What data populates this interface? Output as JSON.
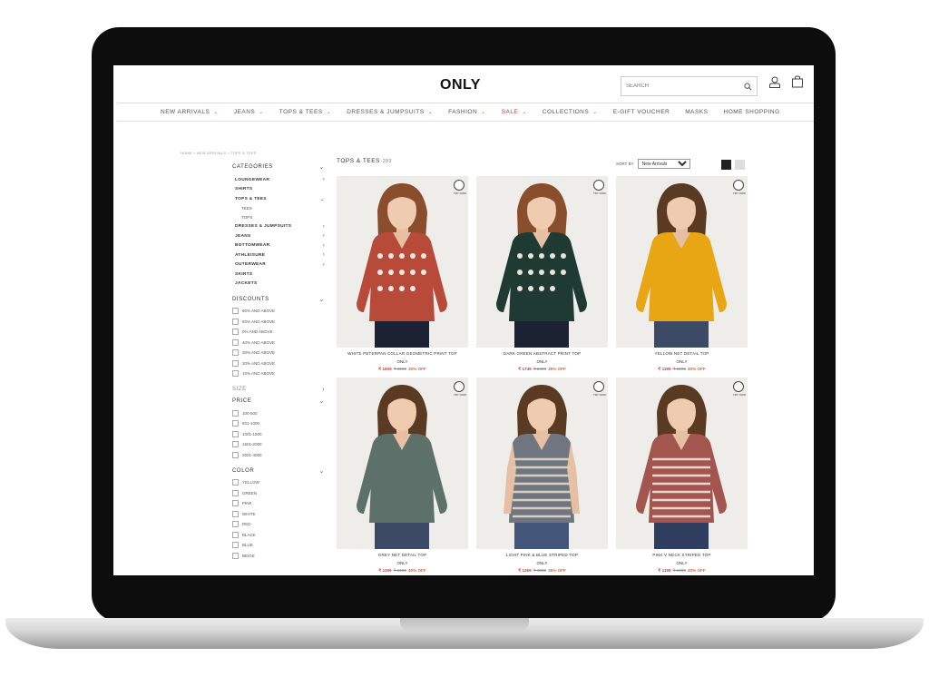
{
  "header": {
    "logo": "ONLY",
    "search_placeholder": "SEARCH"
  },
  "nav": [
    {
      "label": "NEW ARRIVALS",
      "chevron": true,
      "sale": false
    },
    {
      "label": "JEANS",
      "chevron": true,
      "sale": false
    },
    {
      "label": "TOPS & TEES",
      "chevron": true,
      "sale": false
    },
    {
      "label": "DRESSES & JUMPSUITS",
      "chevron": true,
      "sale": false
    },
    {
      "label": "FASHION",
      "chevron": true,
      "sale": false
    },
    {
      "label": "SALE",
      "chevron": true,
      "sale": true
    },
    {
      "label": "COLLECTIONS",
      "chevron": true,
      "sale": false
    },
    {
      "label": "E-GIFT VOUCHER",
      "chevron": false,
      "sale": false
    },
    {
      "label": "MASKS",
      "chevron": false,
      "sale": false
    },
    {
      "label": "HOME SHOPPING",
      "chevron": false,
      "sale": false
    }
  ],
  "breadcrumb": "HOME > NEW ARRIVALS > TOPS & TEES",
  "sidebar": {
    "categories_title": "CATEGORIES",
    "categories": [
      {
        "label": "LOUNGEWEAR",
        "chevron": "right"
      },
      {
        "label": "SHIRTS",
        "chevron": ""
      },
      {
        "label": "TOPS & TEES",
        "chevron": "down",
        "children": [
          "TEES",
          "TOPS"
        ]
      },
      {
        "label": "DRESSES & JUMPSUITS",
        "chevron": "right"
      },
      {
        "label": "JEANS",
        "chevron": "right"
      },
      {
        "label": "BOTTOMWEAR",
        "chevron": "right"
      },
      {
        "label": "ATHLEISURE",
        "chevron": "right"
      },
      {
        "label": "OUTERWEAR",
        "chevron": "right"
      },
      {
        "label": "SKIRTS",
        "chevron": ""
      },
      {
        "label": "JACKETS",
        "chevron": ""
      }
    ],
    "discounts_title": "DISCOUNTS",
    "discounts": [
      "60% AND ABOVE",
      "50% AND ABOVE",
      "0% AND ABOVE",
      "40% AND ABOVE",
      "30% AND ABOVE",
      "20% AND ABOVE",
      "10% AND ABOVE"
    ],
    "size_title": "SIZE",
    "price_title": "PRICE",
    "prices": [
      "100-500",
      "501-1000",
      "1001-1500",
      "1501-2000",
      "2001-4000"
    ],
    "color_title": "COLOR",
    "colors": [
      "YELLOW",
      "GREEN",
      "PINK",
      "WHITE",
      "RED",
      "BLACK",
      "BLUE",
      "BEIGE"
    ]
  },
  "listing": {
    "title": "TOPS & TEES",
    "count": "283",
    "sort_label": "SORT BY",
    "sort_value": "New Arrivals",
    "try_now": "TRY NOW"
  },
  "products": [
    {
      "name": "WHITE PETERPAN COLLAR GEOMETRIC PRINT TOP",
      "brand": "ONLY",
      "price": "₹ 1609",
      "mrp": "₹ 2299",
      "off": "30% OFF",
      "colors": {
        "top": "#b84a3a",
        "accent": "#f4e9e2",
        "bottom": "#1c2233",
        "hair": "#8a4e2c"
      }
    },
    {
      "name": "DARK GREEN ABSTRACT PRINT TOP",
      "brand": "ONLY",
      "price": "₹ 1749",
      "mrp": "₹ 2499",
      "off": "30% OFF",
      "colors": {
        "top": "#1f3a33",
        "accent": "#e8e6d8",
        "bottom": "#1c2233",
        "hair": "#8a4e2c"
      }
    },
    {
      "name": "YELLOW NET DETAIL TOP",
      "brand": "ONLY",
      "price": "₹ 1199",
      "mrp": "₹ 1999",
      "off": "40% OFF",
      "colors": {
        "top": "#e8a615",
        "accent": "#d79510",
        "bottom": "#3c4a66",
        "hair": "#5a3a22"
      }
    },
    {
      "name": "GREY NET DETAIL TOP",
      "brand": "ONLY",
      "price": "₹ 1199",
      "mrp": "₹ 1999",
      "off": "40% OFF",
      "colors": {
        "top": "#5d716a",
        "accent": "#4f625b",
        "bottom": "#3c4a66",
        "hair": "#5a3a22"
      }
    },
    {
      "name": "LIGHT PINK & BLUE STRIPED TOP",
      "brand": "ONLY",
      "price": "₹ 1269",
      "mrp": "₹ 1999",
      "off": "35% OFF",
      "colors": {
        "top": "#6f7680",
        "accent": "#d9cdbf",
        "bottom": "#43567a",
        "hair": "#5a3a22"
      }
    },
    {
      "name": "PINK V NECK STRIPED TOP",
      "brand": "ONLY",
      "price": "₹ 1199",
      "mrp": "₹ 1999",
      "off": "40% OFF",
      "colors": {
        "top": "#a3554f",
        "accent": "#ead6cf",
        "bottom": "#2f3d5e",
        "hair": "#5a3a22"
      }
    }
  ]
}
